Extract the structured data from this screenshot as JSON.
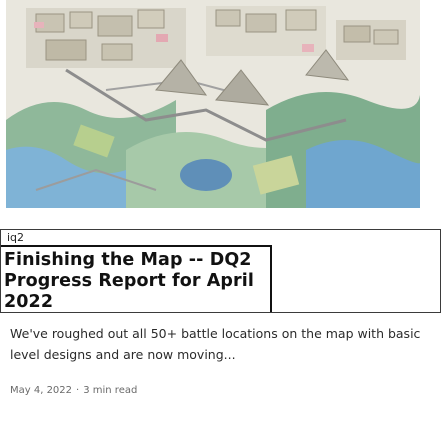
{
  "post": {
    "tag": "iq2",
    "title": "Finishing the Map -- DQ2 Progress Report for April 2022",
    "excerpt": "We've roughed out all 50+ battle locations on the map with basic level designs and are now moving...",
    "date": "May 4, 2022",
    "separator": "·",
    "read_time": "3 min read"
  },
  "colors": {
    "title": "#111111",
    "body_text": "#2b2b2b",
    "meta_text": "#6a6a6a",
    "border": "#3b3b3b"
  }
}
